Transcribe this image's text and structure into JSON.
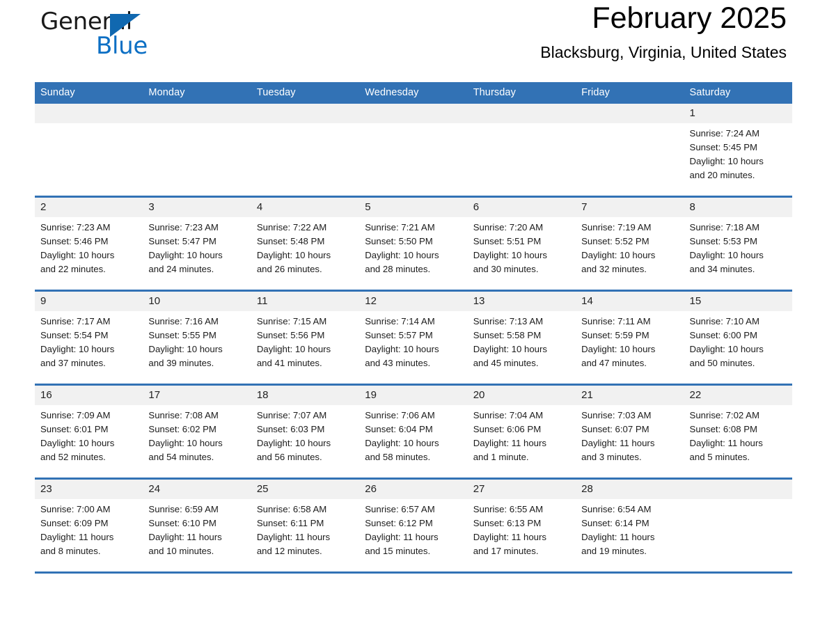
{
  "brand": {
    "name_part1": "General",
    "name_part2": "Blue",
    "triangle_color": "#1068b0",
    "blue_color": "#0c6fc4"
  },
  "header": {
    "title": "February 2025",
    "location": "Blacksburg, Virginia, United States"
  },
  "theme": {
    "header_band": "#3272b5",
    "daynum_band": "#f1f1f1",
    "text": "#1c1c1c"
  },
  "weekday_headers": [
    "Sunday",
    "Monday",
    "Tuesday",
    "Wednesday",
    "Thursday",
    "Friday",
    "Saturday"
  ],
  "weeks": [
    [
      {
        "day": "",
        "blank": true
      },
      {
        "day": "",
        "blank": true
      },
      {
        "day": "",
        "blank": true
      },
      {
        "day": "",
        "blank": true
      },
      {
        "day": "",
        "blank": true
      },
      {
        "day": "",
        "blank": true
      },
      {
        "day": "1",
        "sunrise": "Sunrise: 7:24 AM",
        "sunset": "Sunset: 5:45 PM",
        "daylight1": "Daylight: 10 hours",
        "daylight2": "and 20 minutes."
      }
    ],
    [
      {
        "day": "2",
        "sunrise": "Sunrise: 7:23 AM",
        "sunset": "Sunset: 5:46 PM",
        "daylight1": "Daylight: 10 hours",
        "daylight2": "and 22 minutes."
      },
      {
        "day": "3",
        "sunrise": "Sunrise: 7:23 AM",
        "sunset": "Sunset: 5:47 PM",
        "daylight1": "Daylight: 10 hours",
        "daylight2": "and 24 minutes."
      },
      {
        "day": "4",
        "sunrise": "Sunrise: 7:22 AM",
        "sunset": "Sunset: 5:48 PM",
        "daylight1": "Daylight: 10 hours",
        "daylight2": "and 26 minutes."
      },
      {
        "day": "5",
        "sunrise": "Sunrise: 7:21 AM",
        "sunset": "Sunset: 5:50 PM",
        "daylight1": "Daylight: 10 hours",
        "daylight2": "and 28 minutes."
      },
      {
        "day": "6",
        "sunrise": "Sunrise: 7:20 AM",
        "sunset": "Sunset: 5:51 PM",
        "daylight1": "Daylight: 10 hours",
        "daylight2": "and 30 minutes."
      },
      {
        "day": "7",
        "sunrise": "Sunrise: 7:19 AM",
        "sunset": "Sunset: 5:52 PM",
        "daylight1": "Daylight: 10 hours",
        "daylight2": "and 32 minutes."
      },
      {
        "day": "8",
        "sunrise": "Sunrise: 7:18 AM",
        "sunset": "Sunset: 5:53 PM",
        "daylight1": "Daylight: 10 hours",
        "daylight2": "and 34 minutes."
      }
    ],
    [
      {
        "day": "9",
        "sunrise": "Sunrise: 7:17 AM",
        "sunset": "Sunset: 5:54 PM",
        "daylight1": "Daylight: 10 hours",
        "daylight2": "and 37 minutes."
      },
      {
        "day": "10",
        "sunrise": "Sunrise: 7:16 AM",
        "sunset": "Sunset: 5:55 PM",
        "daylight1": "Daylight: 10 hours",
        "daylight2": "and 39 minutes."
      },
      {
        "day": "11",
        "sunrise": "Sunrise: 7:15 AM",
        "sunset": "Sunset: 5:56 PM",
        "daylight1": "Daylight: 10 hours",
        "daylight2": "and 41 minutes."
      },
      {
        "day": "12",
        "sunrise": "Sunrise: 7:14 AM",
        "sunset": "Sunset: 5:57 PM",
        "daylight1": "Daylight: 10 hours",
        "daylight2": "and 43 minutes."
      },
      {
        "day": "13",
        "sunrise": "Sunrise: 7:13 AM",
        "sunset": "Sunset: 5:58 PM",
        "daylight1": "Daylight: 10 hours",
        "daylight2": "and 45 minutes."
      },
      {
        "day": "14",
        "sunrise": "Sunrise: 7:11 AM",
        "sunset": "Sunset: 5:59 PM",
        "daylight1": "Daylight: 10 hours",
        "daylight2": "and 47 minutes."
      },
      {
        "day": "15",
        "sunrise": "Sunrise: 7:10 AM",
        "sunset": "Sunset: 6:00 PM",
        "daylight1": "Daylight: 10 hours",
        "daylight2": "and 50 minutes."
      }
    ],
    [
      {
        "day": "16",
        "sunrise": "Sunrise: 7:09 AM",
        "sunset": "Sunset: 6:01 PM",
        "daylight1": "Daylight: 10 hours",
        "daylight2": "and 52 minutes."
      },
      {
        "day": "17",
        "sunrise": "Sunrise: 7:08 AM",
        "sunset": "Sunset: 6:02 PM",
        "daylight1": "Daylight: 10 hours",
        "daylight2": "and 54 minutes."
      },
      {
        "day": "18",
        "sunrise": "Sunrise: 7:07 AM",
        "sunset": "Sunset: 6:03 PM",
        "daylight1": "Daylight: 10 hours",
        "daylight2": "and 56 minutes."
      },
      {
        "day": "19",
        "sunrise": "Sunrise: 7:06 AM",
        "sunset": "Sunset: 6:04 PM",
        "daylight1": "Daylight: 10 hours",
        "daylight2": "and 58 minutes."
      },
      {
        "day": "20",
        "sunrise": "Sunrise: 7:04 AM",
        "sunset": "Sunset: 6:06 PM",
        "daylight1": "Daylight: 11 hours",
        "daylight2": "and 1 minute."
      },
      {
        "day": "21",
        "sunrise": "Sunrise: 7:03 AM",
        "sunset": "Sunset: 6:07 PM",
        "daylight1": "Daylight: 11 hours",
        "daylight2": "and 3 minutes."
      },
      {
        "day": "22",
        "sunrise": "Sunrise: 7:02 AM",
        "sunset": "Sunset: 6:08 PM",
        "daylight1": "Daylight: 11 hours",
        "daylight2": "and 5 minutes."
      }
    ],
    [
      {
        "day": "23",
        "sunrise": "Sunrise: 7:00 AM",
        "sunset": "Sunset: 6:09 PM",
        "daylight1": "Daylight: 11 hours",
        "daylight2": "and 8 minutes."
      },
      {
        "day": "24",
        "sunrise": "Sunrise: 6:59 AM",
        "sunset": "Sunset: 6:10 PM",
        "daylight1": "Daylight: 11 hours",
        "daylight2": "and 10 minutes."
      },
      {
        "day": "25",
        "sunrise": "Sunrise: 6:58 AM",
        "sunset": "Sunset: 6:11 PM",
        "daylight1": "Daylight: 11 hours",
        "daylight2": "and 12 minutes."
      },
      {
        "day": "26",
        "sunrise": "Sunrise: 6:57 AM",
        "sunset": "Sunset: 6:12 PM",
        "daylight1": "Daylight: 11 hours",
        "daylight2": "and 15 minutes."
      },
      {
        "day": "27",
        "sunrise": "Sunrise: 6:55 AM",
        "sunset": "Sunset: 6:13 PM",
        "daylight1": "Daylight: 11 hours",
        "daylight2": "and 17 minutes."
      },
      {
        "day": "28",
        "sunrise": "Sunrise: 6:54 AM",
        "sunset": "Sunset: 6:14 PM",
        "daylight1": "Daylight: 11 hours",
        "daylight2": "and 19 minutes."
      },
      {
        "day": "",
        "blank": true
      }
    ]
  ]
}
